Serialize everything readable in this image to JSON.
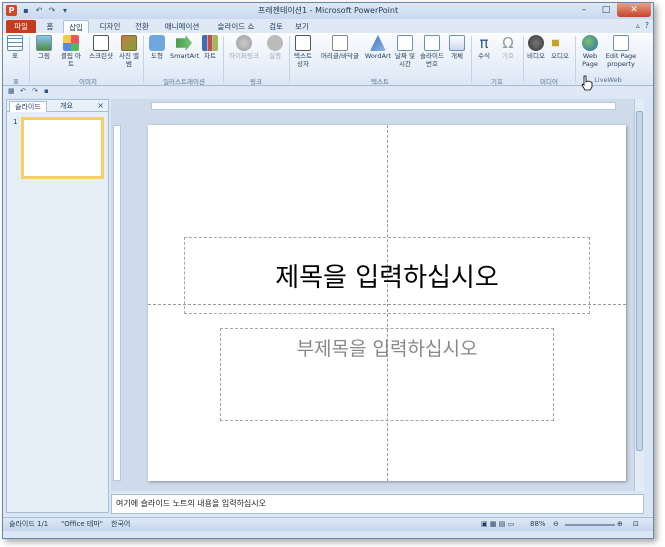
{
  "window": {
    "title": "프레젠테이션1 - Microsoft PowerPoint",
    "controls": [
      "–",
      "□",
      "✕"
    ]
  },
  "tabs": [
    {
      "label": "파일"
    },
    {
      "label": "홈"
    },
    {
      "label": "삽입"
    },
    {
      "label": "디자인"
    },
    {
      "label": "전환"
    },
    {
      "label": "애니메이션"
    },
    {
      "label": "슬라이드 쇼"
    },
    {
      "label": "검토"
    },
    {
      "label": "보기"
    }
  ],
  "ribbon": {
    "buttons": [
      {
        "label": "표",
        "icon": "table-icon"
      },
      {
        "label": "그림",
        "icon": "picture-icon"
      },
      {
        "label": "클립 아트",
        "icon": "clipart-icon"
      },
      {
        "label": "스크린샷",
        "icon": "screenshot-icon"
      },
      {
        "label": "사진 앨범",
        "icon": "photo-album-icon"
      },
      {
        "label": "도형",
        "icon": "shapes-icon"
      },
      {
        "label": "SmartArt",
        "icon": "smartart-icon"
      },
      {
        "label": "차트",
        "icon": "chart-icon"
      },
      {
        "label": "하이퍼링크",
        "icon": "hyperlink-icon"
      },
      {
        "label": "실행",
        "icon": "action-icon"
      },
      {
        "label": "텍스트 상자",
        "icon": "textbox-icon"
      },
      {
        "label": "머리글/바닥글",
        "icon": "header-footer-icon"
      },
      {
        "label": "WordArt",
        "icon": "wordart-icon"
      },
      {
        "label": "날짜 및 시간",
        "icon": "date-time-icon"
      },
      {
        "label": "슬라이드 번호",
        "icon": "slide-number-icon"
      },
      {
        "label": "개체",
        "icon": "object-icon"
      },
      {
        "label": "수식",
        "icon": "equation-icon"
      },
      {
        "label": "기호",
        "icon": "symbol-icon"
      },
      {
        "label": "비디오",
        "icon": "video-icon"
      },
      {
        "label": "오디오",
        "icon": "audio-icon"
      },
      {
        "label": "Web Page",
        "icon": "web-page-icon"
      },
      {
        "label": "Edit Page property",
        "icon": "edit-page-icon"
      }
    ],
    "groups": [
      "표",
      "이미지",
      "일러스트레이션",
      "링크",
      "텍스트",
      "기호",
      "미디어",
      "LiveWeb"
    ]
  },
  "left_panel": {
    "tabs": [
      "슬라이드",
      "개요"
    ],
    "close": "×",
    "slide_number": "1"
  },
  "slide": {
    "title_placeholder": "제목을 입력하십시오",
    "subtitle_placeholder": "부제목을 입력하십시오"
  },
  "notes": {
    "placeholder": "여기에 슬라이드 노트의 내용을 입력하십시오"
  },
  "status": {
    "slide": "슬라이드 1/1",
    "theme": "\"Office 테마\"",
    "language": "한국어",
    "zoom": "88%"
  },
  "colors": {
    "file_tab": "#c33d1e",
    "window_bg": "#dbe6f4",
    "thumb_border": "#f7cf63"
  }
}
